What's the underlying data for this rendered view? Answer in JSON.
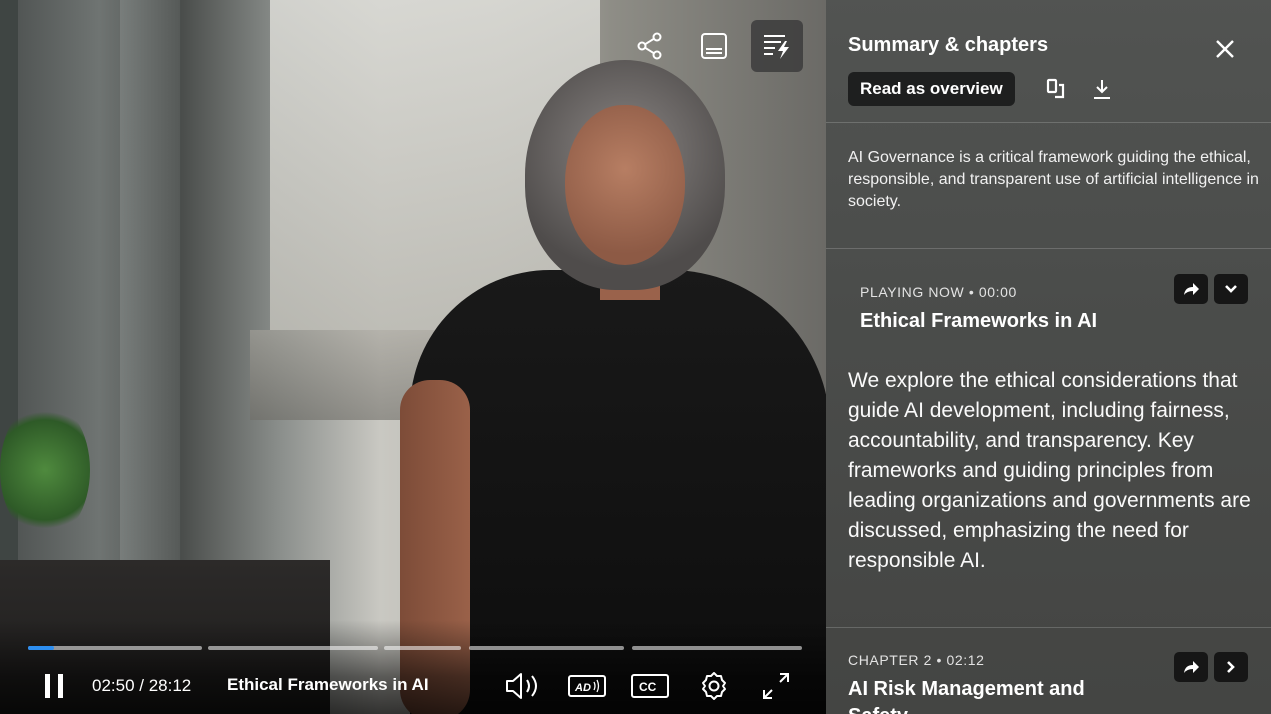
{
  "player": {
    "top_controls": {
      "share_icon": "share-icon",
      "transcript_icon": "transcript-icon",
      "summary_icon": "summary-chapters-icon"
    },
    "progress": {
      "current_time": "02:50",
      "duration": "28:12",
      "time_display": "02:50 / 28:12",
      "played_fraction": 0.1
    },
    "current_chapter": "Ethical Frameworks in AI",
    "accent_color": "#2d8ef0",
    "icons": [
      "pause-icon",
      "volume-icon",
      "audio-description-icon",
      "closed-captions-icon",
      "settings-icon",
      "fullscreen-icon"
    ],
    "ad_label": "AD",
    "cc_label": "CC"
  },
  "panel": {
    "title": "Summary & chapters",
    "overview_button": "Read as overview",
    "summary": "AI Governance is a critical framework guiding the ethical, responsible, and transparent use of artificial intelligence in society.",
    "chapters": [
      {
        "meta": "PLAYING NOW  •  00:00",
        "title": "Ethical Frameworks in AI",
        "description": "We explore the ethical considerations that guide AI development, including fairness, accountability, and transparency. Key frameworks and guiding principles from leading organizations and governments are discussed, emphasizing the need for responsible AI."
      },
      {
        "meta": "CHAPTER 2  •  02:12",
        "title": "AI Risk Management and Safety"
      }
    ]
  }
}
